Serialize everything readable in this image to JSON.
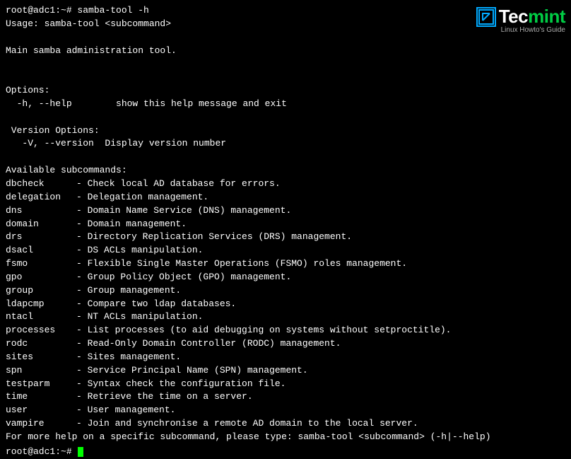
{
  "terminal": {
    "prompt1": "root@adc1:~# samba-tool -h",
    "usage": "Usage: samba-tool <subcommand>",
    "blank1": "",
    "main_desc": "Main samba administration tool.",
    "blank2": "",
    "blank3": "",
    "options_header": "Options:",
    "option_help": "  -h, --help        show this help message and exit",
    "blank4": "",
    "version_header": " Version Options:",
    "version_option": "   -V, --version  Display version number",
    "blank5": "",
    "available_header": "Available subcommands:",
    "subcommands": [
      {
        "name": "  dbcheck",
        "desc": "   - Check local AD database for errors."
      },
      {
        "name": "  delegation",
        "desc": " - Delegation management."
      },
      {
        "name": "  dns",
        "desc": "        - Domain Name Service (DNS) management."
      },
      {
        "name": "  domain",
        "desc": "     - Domain management."
      },
      {
        "name": "  drs",
        "desc": "        - Directory Replication Services (DRS) management."
      },
      {
        "name": "  dsacl",
        "desc": "      - DS ACLs manipulation."
      },
      {
        "name": "  fsmo",
        "desc": "       - Flexible Single Master Operations (FSMO) roles management."
      },
      {
        "name": "  gpo",
        "desc": "        - Group Policy Object (GPO) management."
      },
      {
        "name": "  group",
        "desc": "      - Group management."
      },
      {
        "name": "  ldapcmp",
        "desc": "    - Compare two ldap databases."
      },
      {
        "name": "  ntacl",
        "desc": "      - NT ACLs manipulation."
      },
      {
        "name": "  processes",
        "desc": "  - List processes (to aid debugging on systems without setproctitle)."
      },
      {
        "name": "  rodc",
        "desc": "       - Read-Only Domain Controller (RODC) management."
      },
      {
        "name": "  sites",
        "desc": "      - Sites management."
      },
      {
        "name": "  spn",
        "desc": "        - Service Principal Name (SPN) management."
      },
      {
        "name": "  testparm",
        "desc": "   - Syntax check the configuration file."
      },
      {
        "name": "  time",
        "desc": "       - Retrieve the time on a server."
      },
      {
        "name": "  user",
        "desc": "       - User management."
      },
      {
        "name": "  vampire",
        "desc": "    - Join and synchronise a remote AD domain to the local server."
      }
    ],
    "help_line": "For more help on a specific subcommand, please type: samba-tool <subcommand> (-h|--help)",
    "prompt2": "root@adc1:~# "
  },
  "logo": {
    "icon_symbol": "↗",
    "brand_tec": "Tec",
    "brand_mint": "mint",
    "subtitle": "Linux Howto's Guide"
  }
}
